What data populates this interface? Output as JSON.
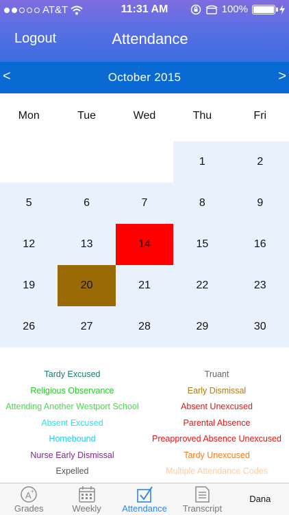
{
  "status_bar": {
    "carrier": "AT&T",
    "time": "11:31 AM",
    "battery": "100%",
    "signal_dots_filled": 2,
    "signal_dots_total": 5
  },
  "nav": {
    "logout_label": "Logout",
    "title": "Attendance"
  },
  "month_bar": {
    "prev_label": "<",
    "next_label": ">",
    "month": "October 2015"
  },
  "weekdays": [
    "Mon",
    "Tue",
    "Wed",
    "Thu",
    "Fri"
  ],
  "calendar": {
    "weeks": [
      [
        null,
        null,
        null,
        "1",
        "2"
      ],
      [
        "5",
        "6",
        "7",
        "8",
        "9"
      ],
      [
        "12",
        "13",
        "14",
        "15",
        "16"
      ],
      [
        "19",
        "20",
        "21",
        "22",
        "23"
      ],
      [
        "26",
        "27",
        "28",
        "29",
        "30"
      ]
    ],
    "highlights": {
      "14": "#ff0000",
      "20": "#9a6a06"
    },
    "cell_color": "#e8f1fc"
  },
  "legend": [
    {
      "label": "Tardy Excused",
      "color": "#1a7a70"
    },
    {
      "label": "Truant",
      "color": "#666666"
    },
    {
      "label": "Religious Observance",
      "color": "#22cc22"
    },
    {
      "label": "Early Dismissal",
      "color": "#b07a10"
    },
    {
      "label": "Attending Another Westport School",
      "color": "#44dd44"
    },
    {
      "label": "Absent Unexcused",
      "color": "#ee1111"
    },
    {
      "label": "Absent Excused",
      "color": "#22e8e8"
    },
    {
      "label": "Parental Absence",
      "color": "#ee1111"
    },
    {
      "label": "Homebound",
      "color": "#22ccee"
    },
    {
      "label": "Preapproved Absence Unexcused",
      "color": "#ee1111"
    },
    {
      "label": "Nurse Early Dismissal",
      "color": "#7a2a8a"
    },
    {
      "label": "Tardy Unexcused",
      "color": "#ff7711"
    },
    {
      "label": "Expelled",
      "color": "#555555"
    },
    {
      "label": "Multiple Attendance Codes",
      "color": "#ffcc99"
    }
  ],
  "tabs": [
    {
      "label": "Grades",
      "icon": "grade-a-plus-icon",
      "active": false
    },
    {
      "label": "Weekly",
      "icon": "calendar-icon",
      "active": false
    },
    {
      "label": "Attendance",
      "icon": "checkbox-icon",
      "active": true
    },
    {
      "label": "Transcript",
      "icon": "document-icon",
      "active": false
    },
    {
      "label": "Dana",
      "icon": "",
      "active": false
    }
  ],
  "colors": {
    "accent": "#2f86e8",
    "month_bar": "#0a6ad4"
  }
}
